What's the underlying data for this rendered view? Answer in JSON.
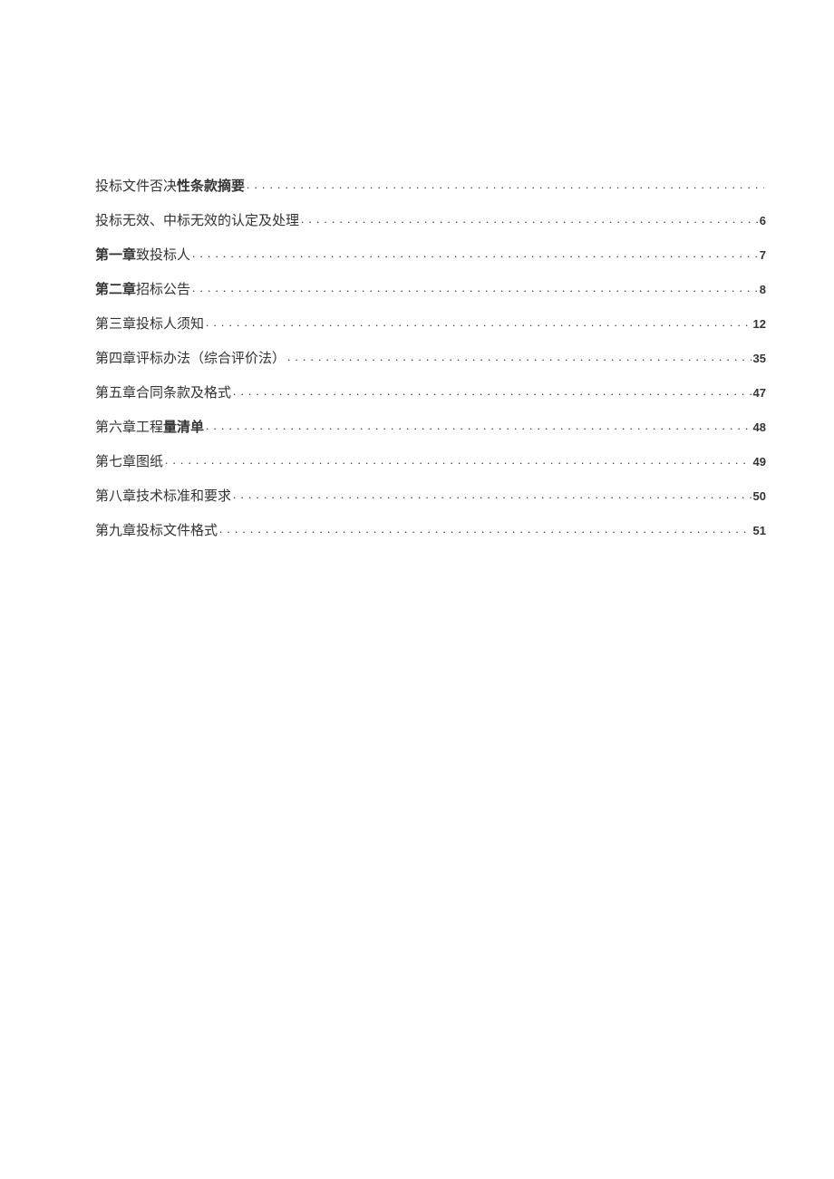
{
  "toc": {
    "entries": [
      {
        "title_prefix": "",
        "bold_prefix": "",
        "title": "投标文件否决",
        "bold_suffix": "性条款摘要",
        "title_suffix": "",
        "page": ""
      },
      {
        "title_prefix": "",
        "bold_prefix": "",
        "title": "投标无效、中标无效的认定及处理",
        "bold_suffix": "",
        "title_suffix": "",
        "page": "6"
      },
      {
        "title_prefix": "",
        "bold_prefix": "第一章",
        "title": "致投标人",
        "bold_suffix": "",
        "title_suffix": "",
        "page": "7"
      },
      {
        "title_prefix": "",
        "bold_prefix": "第二章",
        "title": "招标公告",
        "bold_suffix": "",
        "title_suffix": "",
        "page": "8"
      },
      {
        "title_prefix": "",
        "bold_prefix": "",
        "title": "第三章投标人须知",
        "bold_suffix": "",
        "title_suffix": "",
        "page": "12"
      },
      {
        "title_prefix": "",
        "bold_prefix": "",
        "title": "第四章评标办法（综合评价法）",
        "bold_suffix": "",
        "title_suffix": "",
        "page": "35"
      },
      {
        "title_prefix": "",
        "bold_prefix": "",
        "title": "第五章合同条款及格式",
        "bold_suffix": "",
        "title_suffix": "",
        "page": "47"
      },
      {
        "title_prefix": "",
        "bold_prefix": "",
        "title": "第六章工程",
        "bold_suffix": "量清单",
        "title_suffix": "",
        "page": "48"
      },
      {
        "title_prefix": "",
        "bold_prefix": "",
        "title": "第七章图纸",
        "bold_suffix": "",
        "title_suffix": "",
        "page": "49"
      },
      {
        "title_prefix": "",
        "bold_prefix": "",
        "title": "第八章技术标准和要求",
        "bold_suffix": "",
        "title_suffix": "",
        "page": "50"
      },
      {
        "title_prefix": "",
        "bold_prefix": "",
        "title": "第九章投标文件格式",
        "bold_suffix": "",
        "title_suffix": "",
        "page": "51"
      }
    ]
  }
}
